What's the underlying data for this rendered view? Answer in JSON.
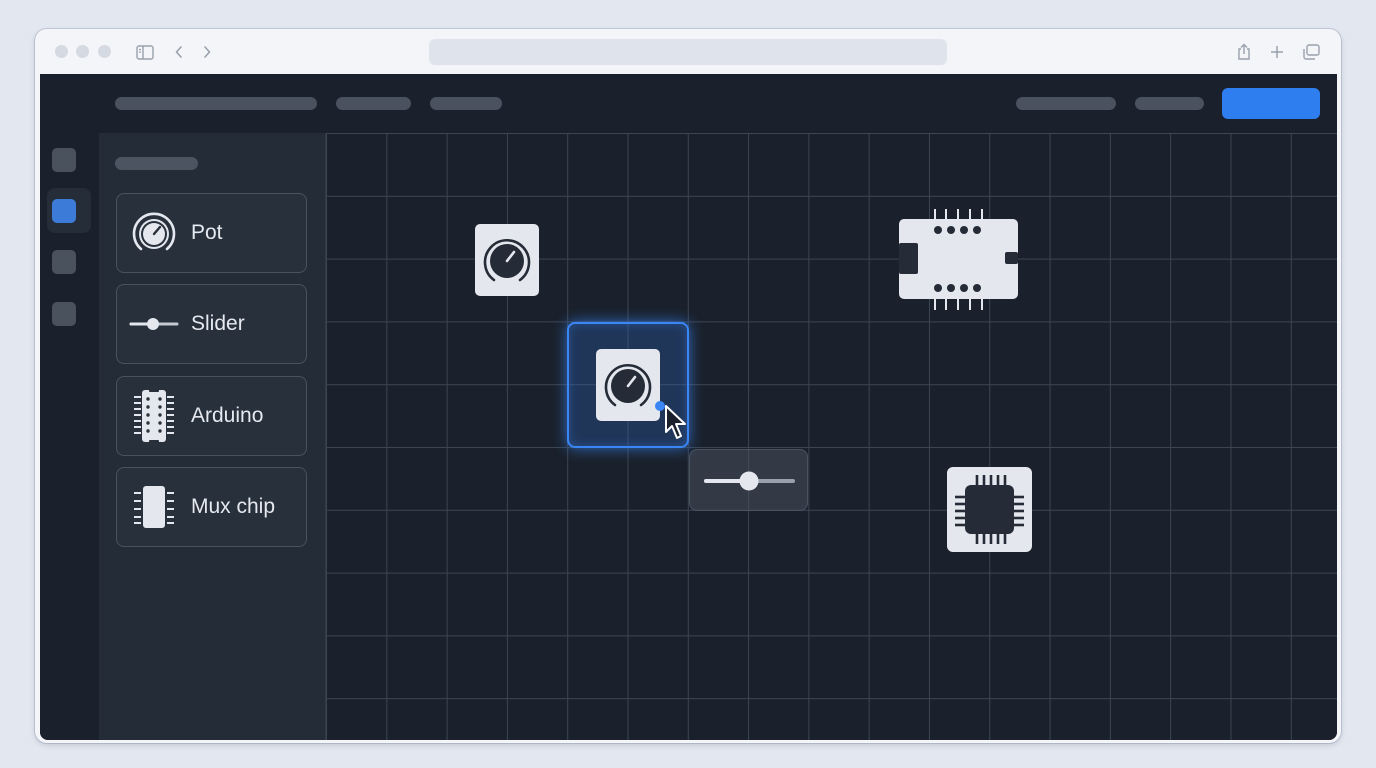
{
  "browser": {
    "icons": [
      "sidebar-toggle-icon",
      "back-icon",
      "forward-icon",
      "share-icon",
      "new-tab-icon",
      "tabs-overview-icon"
    ]
  },
  "app": {
    "accent_color": "#2f7ef0",
    "background_color": "#1a212c",
    "rail": {
      "items": [
        {
          "name": "rail-item-1",
          "active": false
        },
        {
          "name": "rail-item-2",
          "active": true
        },
        {
          "name": "rail-item-3",
          "active": false
        },
        {
          "name": "rail-item-4",
          "active": false
        }
      ]
    },
    "palette": {
      "items": [
        {
          "label": "Pot",
          "icon": "potentiometer-icon"
        },
        {
          "label": "Slider",
          "icon": "slider-icon"
        },
        {
          "label": "Arduino",
          "icon": "arduino-board-icon"
        },
        {
          "label": "Mux chip",
          "icon": "mux-chip-icon"
        }
      ]
    },
    "canvas": {
      "grid": true,
      "components": [
        {
          "type": "potentiometer",
          "icon": "potentiometer-icon",
          "selected": false
        },
        {
          "type": "potentiometer",
          "icon": "potentiometer-icon",
          "selected": true
        },
        {
          "type": "slider",
          "icon": "slider-icon",
          "state": "dragging"
        },
        {
          "type": "arduino",
          "icon": "arduino-board-icon",
          "selected": false
        },
        {
          "type": "mux-chip",
          "icon": "mux-chip-icon",
          "selected": false
        }
      ],
      "cursor": "arrow-cursor-icon"
    }
  }
}
